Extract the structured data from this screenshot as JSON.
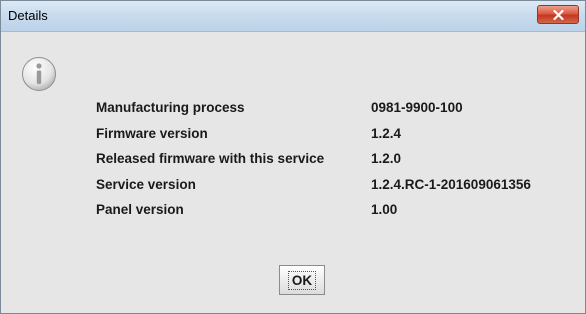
{
  "window": {
    "title": "Details"
  },
  "details": [
    {
      "label": "Manufacturing process",
      "value": "0981-9900-100"
    },
    {
      "label": "Firmware version",
      "value": "1.2.4"
    },
    {
      "label": "Released firmware with this service",
      "value": "1.2.0"
    },
    {
      "label": "Service version",
      "value": "1.2.4.RC-1-201609061356"
    },
    {
      "label": "Panel version",
      "value": "1.00"
    }
  ],
  "buttons": {
    "ok_label": "OK"
  },
  "icons": {
    "dialog": "info-icon",
    "close": "close-icon"
  }
}
